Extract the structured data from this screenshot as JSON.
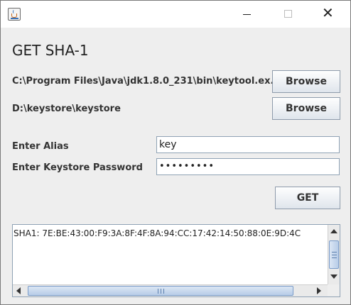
{
  "window": {
    "title": "",
    "icons": {
      "app": "java-cup-icon",
      "minimize": "minimize-icon",
      "maximize": "maximize-icon",
      "close": "close-icon"
    },
    "close_glyph": "✕"
  },
  "heading": "GET SHA-1",
  "keytool": {
    "path": "C:\\Program Files\\Java\\jdk1.8.0_231\\bin\\keytool.ex..",
    "browse_label": "Browse"
  },
  "keystore": {
    "path": "D:\\keystore\\keystore",
    "browse_label": "Browse"
  },
  "alias": {
    "label": "Enter Alias",
    "value": "key"
  },
  "password": {
    "label": "Enter Keystore Password",
    "value": "•••••••••"
  },
  "get_label": "GET",
  "output": {
    "text": "SHA1: 7E:BE:43:00:F9:3A:8F:4F:8A:94:CC:17:42:14:50:88:0E:9D:4C"
  },
  "colors": {
    "window_bg": "#eeeeee",
    "button_border": "#8e9bab",
    "field_border": "#8fa2b4",
    "scroll_thumb": "#b8cde8"
  }
}
